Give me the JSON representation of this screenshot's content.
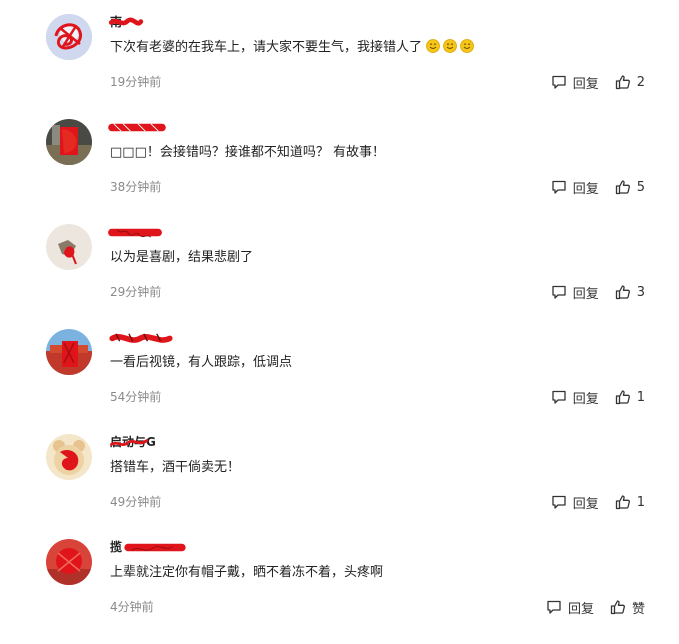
{
  "comments": [
    {
      "username": "南",
      "text": "下次有老婆的在我车上，请大家不要生气，我接错人了",
      "time": "19分钟前",
      "reply_label": "回复",
      "likes": "2",
      "avatar_bg": "#c9d3ea"
    },
    {
      "username": "",
      "text": "□□□！会接错吗？接谁都不知道吗？ 有故事！",
      "time": "38分钟前",
      "reply_label": "回复",
      "likes": "5",
      "avatar_bg": "#5a5a55"
    },
    {
      "username": "",
      "text": "以为是喜剧，结果悲剧了",
      "time": "29分钟前",
      "reply_label": "回复",
      "likes": "3",
      "avatar_bg": "#e8e2dc"
    },
    {
      "username": "",
      "text": "一看后视镜，有人跟踪，低调点",
      "time": "54分钟前",
      "reply_label": "回复",
      "likes": "1",
      "avatar_bg": "#6fa6d8"
    },
    {
      "username": "启动与G",
      "text": "搭错车，酒干倘卖无！",
      "time": "49分钟前",
      "reply_label": "回复",
      "likes": "1",
      "avatar_bg": "#f1e2c5"
    },
    {
      "username": "揽",
      "text": "上辈就注定你有帽子戴，晒不着冻不着，头疼啊",
      "time": "4分钟前",
      "reply_label": "回复",
      "likes": "赞",
      "avatar_bg": "#d8433a"
    }
  ],
  "colors": {
    "redaction": "#e0141b",
    "time": "#8a8a8a",
    "emoji": "#f5c518"
  },
  "icons": {
    "reply": "speech-bubble-icon",
    "like": "thumbs-up-icon",
    "emoji": "smiley-emoji-icon"
  }
}
